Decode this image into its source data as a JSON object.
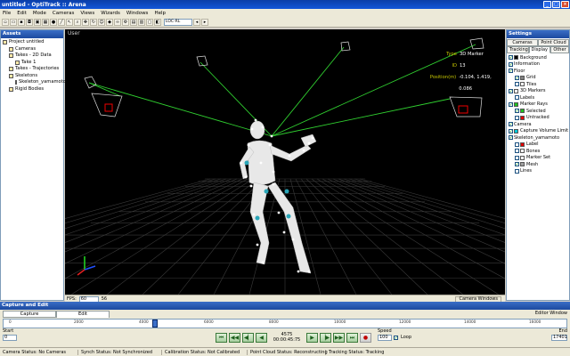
{
  "window": {
    "title": "untitled - OptiTrack :: Arena"
  },
  "menu": [
    "File",
    "Edit",
    "Mode",
    "Cameras",
    "Views",
    "Wizards",
    "Windows",
    "Help"
  ],
  "toolbar": {
    "view_select": "LOC-RL"
  },
  "assets": {
    "title": "Assets",
    "items": [
      {
        "label": "Project untitled",
        "indent": 0
      },
      {
        "label": "Cameras",
        "indent": 1
      },
      {
        "label": "Takes - 2D Data",
        "indent": 1
      },
      {
        "label": "Take 1",
        "indent": 2
      },
      {
        "label": "Takes - Trajectories",
        "indent": 1
      },
      {
        "label": "Skeletons",
        "indent": 1
      },
      {
        "label": "Skeleton_yamamoto",
        "indent": 2
      },
      {
        "label": "Rigid Bodies",
        "indent": 1
      }
    ]
  },
  "viewport": {
    "label": "User",
    "info": [
      {
        "key": "Type",
        "value": "3D Marker"
      },
      {
        "key": "ID",
        "value": "13"
      },
      {
        "key": "Position(m)",
        "value": "-0.104, 1.419, 0.086"
      }
    ],
    "fps_label": "FPS:",
    "fps_value": "60",
    "fps_extra": "56",
    "camera_windows": "Camera Windows"
  },
  "settings": {
    "title": "Settings",
    "tabs_row1": [
      "Cameras",
      "Point Cloud"
    ],
    "tabs_row2": [
      "Tracking",
      "Display",
      "Other"
    ],
    "active_tab": "Display",
    "items": [
      {
        "label": "Background",
        "indent": 0,
        "checked": true,
        "swatch": "#000000"
      },
      {
        "label": "Information",
        "indent": 0,
        "checked": true,
        "swatch": ""
      },
      {
        "label": "Floor",
        "indent": 0,
        "checked": true,
        "swatch": ""
      },
      {
        "label": "Grid",
        "indent": 1,
        "checked": true,
        "swatch": "#808080"
      },
      {
        "label": "Tiles",
        "indent": 1,
        "checked": false,
        "swatch": "#ffffff"
      },
      {
        "label": "3D Markers",
        "indent": 0,
        "checked": true,
        "swatch": "#ffffff"
      },
      {
        "label": "Labels",
        "indent": 1,
        "checked": false,
        "swatch": ""
      },
      {
        "label": "Marker Rays",
        "indent": 0,
        "checked": true,
        "swatch": "#20c020"
      },
      {
        "label": "Selected",
        "indent": 1,
        "checked": true,
        "swatch": "#20c020"
      },
      {
        "label": "Untracked",
        "indent": 1,
        "checked": false,
        "swatch": "#e00000"
      },
      {
        "label": "Camera",
        "indent": 0,
        "checked": true,
        "swatch": ""
      },
      {
        "label": "Capture Volume Limit",
        "indent": 0,
        "checked": true,
        "swatch": "#00c8d8"
      },
      {
        "label": "Skeleton_yamamoto",
        "indent": 0,
        "checked": true,
        "swatch": ""
      },
      {
        "label": "Label",
        "indent": 1,
        "checked": false,
        "swatch": "#e00000"
      },
      {
        "label": "Bones",
        "indent": 1,
        "checked": false,
        "swatch": "#ffffff"
      },
      {
        "label": "Marker Set",
        "indent": 1,
        "checked": false,
        "swatch": "#ffffff"
      },
      {
        "label": "Mesh",
        "indent": 1,
        "checked": true,
        "swatch": "#a0a0a0"
      },
      {
        "label": "Lines",
        "indent": 1,
        "checked": false,
        "swatch": ""
      }
    ]
  },
  "capture": {
    "title": "Capture and Edit",
    "tabs": [
      "Capture",
      "Edit"
    ],
    "active_tab": "Edit",
    "editor_window": "Editor Window",
    "ticks": [
      "0",
      "2000",
      "4000",
      "6000",
      "8000",
      "10000",
      "12000",
      "14000",
      "16000"
    ],
    "start_label": "Start",
    "start_value": "0",
    "end_label": "End",
    "end_value": "17401",
    "frame_number": "4575",
    "timecode": "00:00:45:75",
    "speed_label": "Speed",
    "speed_value": "100",
    "loop_label": "Loop",
    "loop_checked": true
  },
  "status": [
    "Camera Status: No Cameras",
    "Synch Status: Not Synchronized",
    "Calibration Status: Not Calibrated",
    "Point Cloud Status: Reconstructing",
    "Tracking Status: Tracking"
  ]
}
